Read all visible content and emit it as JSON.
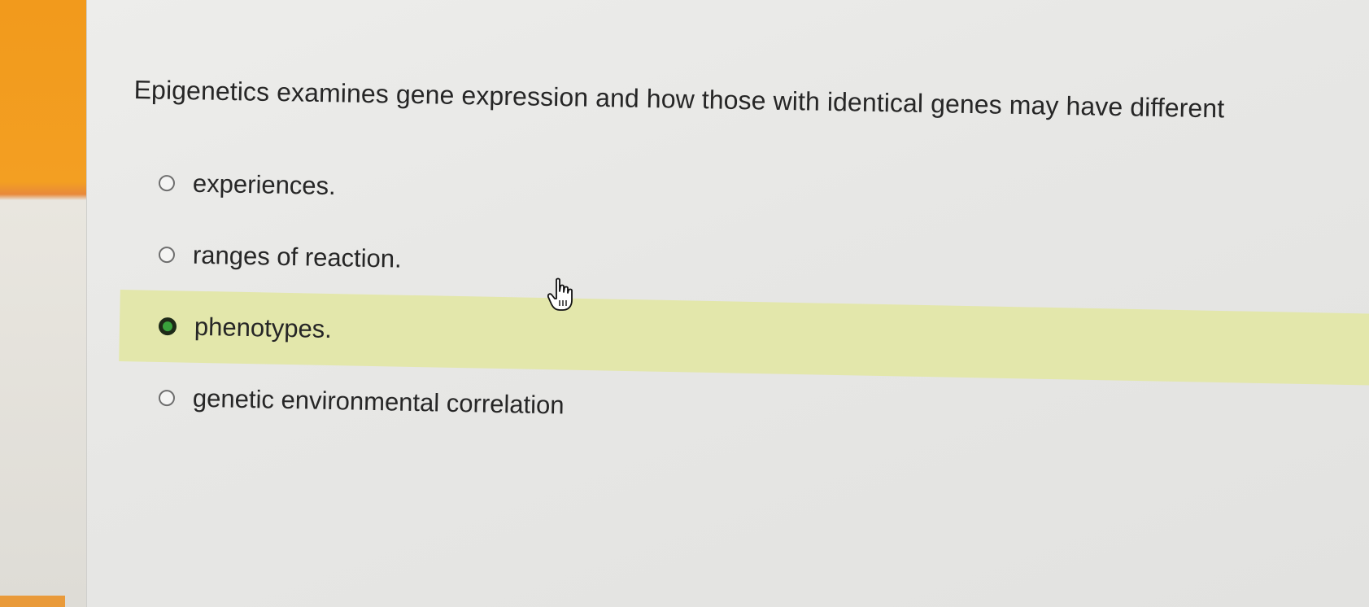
{
  "question": {
    "text": "Epigenetics examines gene expression and how those with identical genes may have different"
  },
  "choices": [
    {
      "label": "experiences.",
      "selected": false
    },
    {
      "label": "ranges of reaction.",
      "selected": false
    },
    {
      "label": "phenotypes.",
      "selected": true
    },
    {
      "label": "genetic environmental correlation",
      "selected": false
    }
  ],
  "colors": {
    "selected_highlight": "#e3e7ab",
    "selected_radio": "#39a13c",
    "background": "#e7e7e5"
  },
  "cursor": {
    "icon": "hand-pointer-icon"
  }
}
